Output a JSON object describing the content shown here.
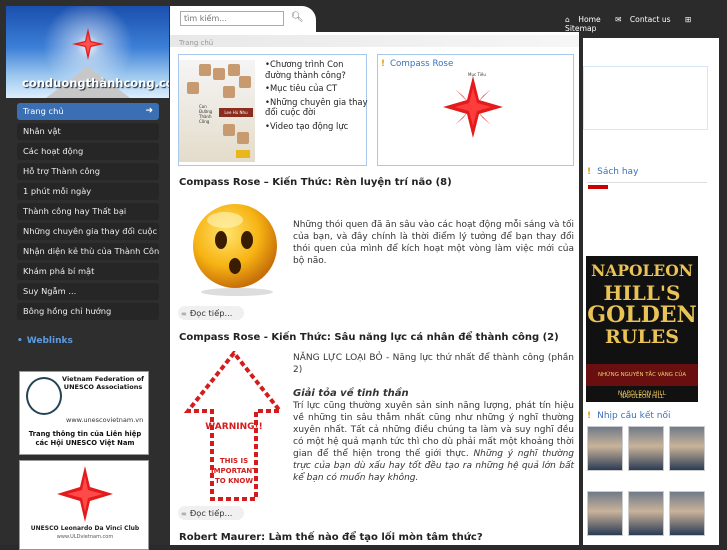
{
  "site": {
    "logo_text": "conduongthànhcong.com"
  },
  "search": {
    "placeholder": "tìm kiếm..."
  },
  "toplinks": {
    "home": "Home",
    "contact": "Contact us",
    "sitemap": "Sitemap"
  },
  "nav": {
    "items": [
      {
        "label": "Trang chủ"
      },
      {
        "label": "Nhân vật"
      },
      {
        "label": "Các hoạt động"
      },
      {
        "label": "Hỗ trợ Thành công"
      },
      {
        "label": "1 phút mỗi ngày"
      },
      {
        "label": "Thành công hay Thất bại"
      },
      {
        "label": "Những chuyên gia thay đổi cuộc đời"
      },
      {
        "label": "Nhận diện kẻ thù của Thành Công"
      },
      {
        "label": "Khám phá bí mật"
      },
      {
        "label": "Suy Ngẫm ..."
      },
      {
        "label": "Bông hồng chỉ hướng"
      }
    ]
  },
  "weblinks": {
    "label": "Weblinks"
  },
  "unesco1": {
    "t1": "Vietnam Federation of UNESCO Associations",
    "url": "www.unescovietnam.vn",
    "t2": "Trang thông tin của Liên hiệp các Hội UNESCO Việt Nam"
  },
  "unesco2": {
    "title": "UNESCO Leonardo Da Vinci Club",
    "url": "www.ULDvietnam.com"
  },
  "breadcrumb": "Trang chủ",
  "box1": {
    "book_title": "Con Đường Thành Công",
    "book_author": "Lee Hú Nhu",
    "links": [
      "•Chương trình Con đường thành công?",
      "•Mục tiêu của CT",
      "•Những chuyên gia thay đổi cuộc đời",
      "•Video tạo động lực"
    ]
  },
  "box2": {
    "title": "Compass Rose",
    "caption": "Mục Tiêu"
  },
  "articles": [
    {
      "title": "Compass Rose – Kiến Thức: Rèn luyện trí não (8)",
      "text": "Những thói quen đã ăn sâu vào các hoạt động mỗi sáng và tối của bạn, và đây chính là thời điểm lý tưởng để bạn thay đổi thói quen của mình để kích hoạt một vòng làm việc mới của bộ não.",
      "more": "Đọc tiếp..."
    },
    {
      "title": "Compass Rose - Kiến Thức: Sâu năng lực cá nhân để thành công (2)",
      "intro": "NĂNG LỰC LOẠI BỎ  - Năng lực thứ nhất để thành công (phần 2)",
      "subhead": "Giải tỏa về tinh thần",
      "body": "Trí lực cũng thường xuyên sản sinh năng lượng, phát tín hiệu về những tin sâu thẳm nhất cũng như những ý nghĩ thường xuyên nhất. Tất cả những điều chúng ta làm và suy nghĩ đều có một hệ quả mạnh tức thì cho dù phải mất một khoảng thời gian để thể hiện trong thế giới thực.",
      "body_italic": "Những ý nghĩ thường trực của bạn dù xấu hay tốt đều tạo ra những hệ quả lớn bất kể bạn có muốn hay không.",
      "warning_title": "WARNING!!",
      "warning_text": "THIS IS IMPORTANT TO KNOW",
      "more": "Đọc tiếp..."
    },
    {
      "title": "Robert Maurer: Làm thế nào để tạo lối mòn tâm thức?"
    }
  ],
  "right": {
    "sach_title": "Sách hay",
    "book": {
      "l1": "NAPOLEON",
      "l2": "HILL'S",
      "l3": "GOLDEN",
      "l4": "RULES",
      "sub": "NHỮNG NGUYÊN TẮC VÀNG CỦA NAPOLEON HILL",
      "author": "NAPOLEON HILL"
    },
    "nhip_title": "Nhịp cầu kết nối"
  },
  "colors": {
    "accent": "#3b71b8",
    "active_nav": "#3a6fb4",
    "sidebar": "#2e2e2e"
  }
}
